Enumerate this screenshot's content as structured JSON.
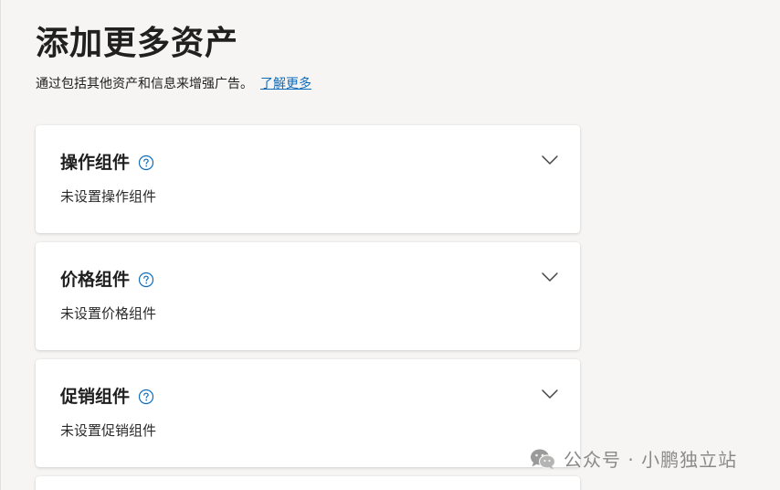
{
  "header": {
    "title": "添加更多资产",
    "subtitle": "通过包括其他资产和信息来增强广告。",
    "learn_more": "了解更多"
  },
  "cards": [
    {
      "title": "操作组件",
      "status": "未设置操作组件",
      "help_icon": "question-circle-icon",
      "expand_icon": "chevron-down-icon"
    },
    {
      "title": "价格组件",
      "status": "未设置价格组件",
      "help_icon": "question-circle-icon",
      "expand_icon": "chevron-down-icon"
    },
    {
      "title": "促销组件",
      "status": "未设置促销组件",
      "help_icon": "question-circle-icon",
      "expand_icon": "chevron-down-icon"
    }
  ],
  "watermark": {
    "text": "公众号 · 小鹏独立站",
    "icon": "wechat-icon"
  },
  "colors": {
    "background": "#f6f5f3",
    "link": "#0f6cbd",
    "help_icon": "#0f6cbd",
    "card": "#ffffff"
  }
}
